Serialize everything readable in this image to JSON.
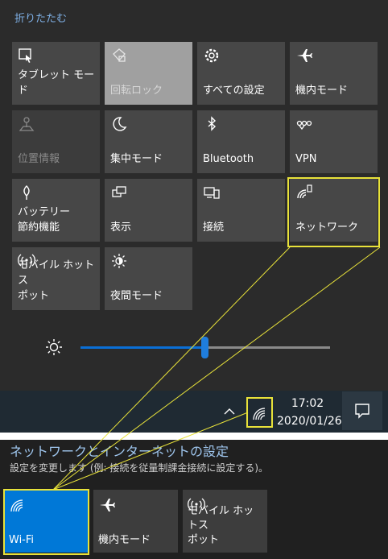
{
  "action_center": {
    "collapse_label": "折りたたむ",
    "tiles": [
      {
        "label": "タブレット モード",
        "icon": "tablet-mode-icon",
        "state": "normal"
      },
      {
        "label": "回転ロック",
        "icon": "rotation-lock-icon",
        "state": "light"
      },
      {
        "label": "すべての設定",
        "icon": "gear-icon",
        "state": "normal"
      },
      {
        "label": "機内モード",
        "icon": "airplane-icon",
        "state": "normal"
      },
      {
        "label": "位置情報",
        "icon": "location-icon",
        "state": "disabled"
      },
      {
        "label": "集中モード",
        "icon": "moon-icon",
        "state": "normal"
      },
      {
        "label": "Bluetooth",
        "icon": "bluetooth-icon",
        "state": "normal"
      },
      {
        "label": "VPN",
        "icon": "vpn-icon",
        "state": "normal"
      },
      {
        "label": "バッテリー\n節約機能",
        "icon": "battery-saver-icon",
        "state": "normal"
      },
      {
        "label": "表示",
        "icon": "project-icon",
        "state": "normal"
      },
      {
        "label": "接続",
        "icon": "connect-icon",
        "state": "normal"
      },
      {
        "label": "ネットワーク",
        "icon": "network-icon",
        "state": "normal"
      },
      {
        "label": "モバイル ホットス\nポット",
        "icon": "hotspot-icon",
        "state": "normal"
      },
      {
        "label": "夜間モード",
        "icon": "night-light-icon",
        "state": "normal"
      }
    ],
    "brightness_level": 0.5
  },
  "taskbar": {
    "time": "17:02",
    "date": "2020/01/26"
  },
  "network_settings": {
    "title": "ネットワークとインターネットの設定",
    "subtitle": "設定を変更します (例: 接続を従量制課金接続に設定する)。",
    "tiles": [
      {
        "label": "Wi-Fi",
        "icon": "wifi-icon",
        "state": "on"
      },
      {
        "label": "機内モード",
        "icon": "airplane-icon",
        "state": "off"
      },
      {
        "label": "モバイル ホットス\nポット",
        "icon": "hotspot-icon",
        "state": "off"
      }
    ]
  },
  "colors": {
    "accent": "#0078d7",
    "highlight": "#e8e23a",
    "link": "#7fb0e6"
  }
}
